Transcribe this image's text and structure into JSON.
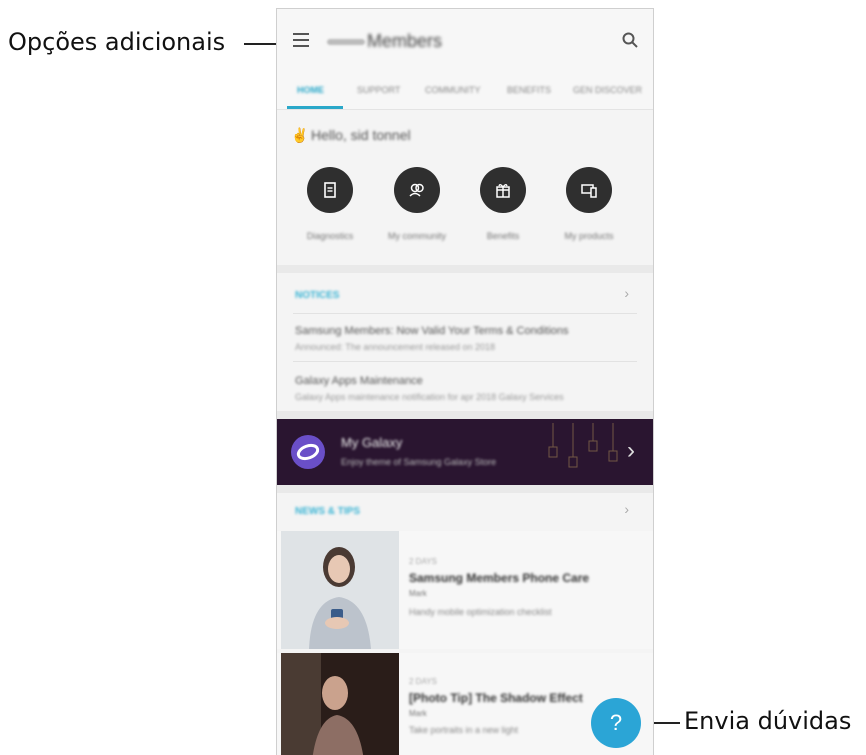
{
  "callouts": {
    "options": "Opções adicionais",
    "faq": "Envia dúvidas"
  },
  "app": {
    "title": "Members",
    "tabs": [
      "HOME",
      "SUPPORT",
      "COMMUNITY",
      "BENEFITS",
      "GEN DISCOVER"
    ]
  },
  "greeting": "Hello, sid tonnel",
  "quick_actions": [
    "Diagnostics",
    "My community",
    "Benefits",
    "My products"
  ],
  "notices": {
    "header": "NOTICES",
    "items": [
      {
        "title": "Samsung Members: Now Valid Your Terms & Conditions",
        "sub": "Announced: The announcement released on 2018"
      },
      {
        "title": "Galaxy Apps Maintenance",
        "sub": "Galaxy Apps maintenance notification for apr 2018 Galaxy Services"
      }
    ]
  },
  "banner": {
    "title": "My Galaxy",
    "sub": "Enjoy theme of Samsung Galaxy Store"
  },
  "news": {
    "header": "NEWS & TIPS",
    "cards": [
      {
        "meta": "2 DAYS",
        "title": "Samsung Members Phone Care",
        "author": "Mark",
        "desc": "Handy mobile optimization checklist"
      },
      {
        "meta": "2 DAYS",
        "title": "[Photo Tip] The Shadow Effect",
        "author": "Mark",
        "desc": "Take portraits in a new light"
      }
    ]
  },
  "fab": "?",
  "colors": {
    "accent": "#2aa8c9",
    "fab": "#2ba5d6",
    "banner": "#2a1530"
  }
}
